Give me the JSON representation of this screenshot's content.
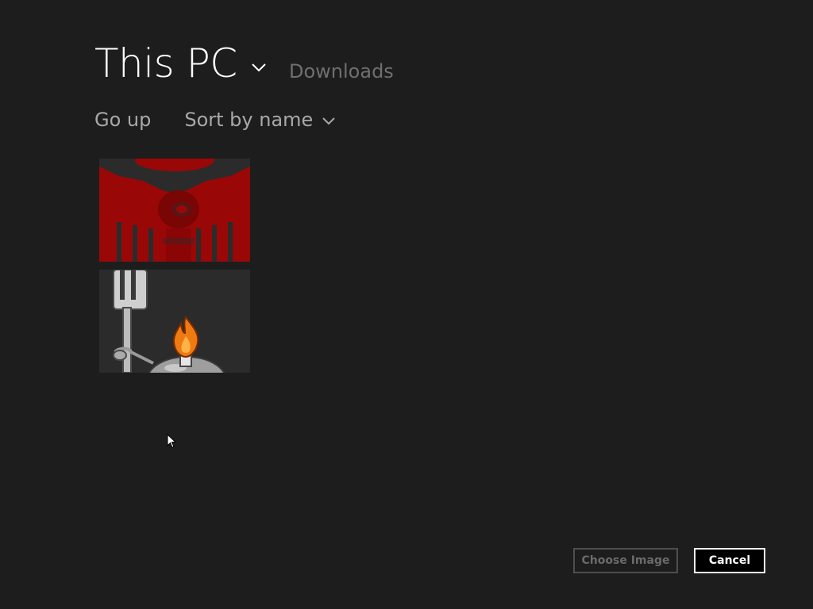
{
  "header": {
    "location_title": "This PC",
    "location_icon": "chevron-down-icon",
    "current_folder": "Downloads"
  },
  "toolbar": {
    "go_up_label": "Go up",
    "sort_label": "Sort by name",
    "sort_icon": "chevron-down-icon"
  },
  "files": [
    {
      "name": "red-emblem-thumbnail",
      "accent": "#9a0707"
    },
    {
      "name": "fork-bomb-thumbnail",
      "accent": "#f07a12"
    }
  ],
  "footer": {
    "choose_label": "Choose Image",
    "cancel_label": "Cancel"
  },
  "colors": {
    "background": "#1d1d1d",
    "text_primary": "#ffffff",
    "text_secondary": "#a8a8a8",
    "text_muted": "#6f6f6f"
  }
}
